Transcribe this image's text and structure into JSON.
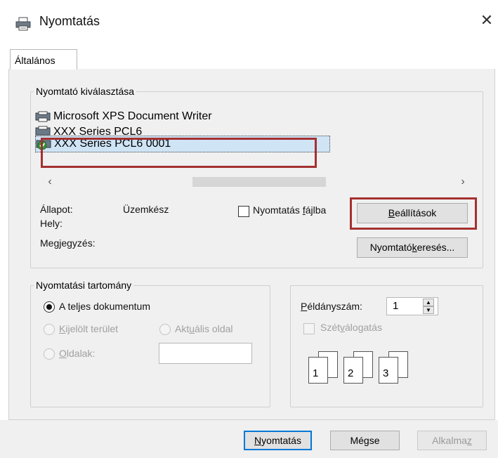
{
  "window": {
    "title": "Nyomtatás",
    "close_glyph": "✕",
    "icon": "printer-icon"
  },
  "tabs": [
    {
      "label": "Általános"
    }
  ],
  "printer_select": {
    "group_label": "Nyomtató kiválasztása",
    "printers": [
      {
        "name": "Microsoft XPS Document Writer",
        "icon": "printer-icon"
      },
      {
        "name": "XXX  Series PCL6",
        "icon": "printer-icon"
      },
      {
        "name": "XXX  Series PCL6 0001",
        "icon": "default-printer-icon",
        "selected": true
      }
    ],
    "scroll_left": "‹",
    "scroll_right": "›",
    "status_label": "Állapot:",
    "status_value": "Üzemkész",
    "location_label": "Hely:",
    "comment_label": "Megjegyzés:",
    "print_to_file": {
      "before": "Nyomtatás ",
      "u": "f",
      "after": "ájlba",
      "checked": false
    },
    "settings_button": {
      "u": "B",
      "after": "eállítások"
    },
    "find_button": {
      "before": "Nyomtató",
      "u": "k",
      "after": "eresés..."
    }
  },
  "page_range": {
    "group_label": "Nyomtatási tartomány",
    "all": {
      "before": "A tel",
      "u": "j",
      "after": "es dokumentum",
      "checked": true
    },
    "selection": {
      "u": "K",
      "after": "ijelölt terület",
      "enabled": false
    },
    "current": {
      "before": "Akt",
      "u": "u",
      "after": "ális oldal",
      "enabled": false
    },
    "pages": {
      "u": "O",
      "after": "ldalak:",
      "enabled": false,
      "value": ""
    }
  },
  "copies": {
    "label_u": "P",
    "label_after": "éldányszám:",
    "value": "1",
    "spin_up": "▲",
    "spin_down": "▼",
    "collate": {
      "before": "Szét",
      "u": "v",
      "after": "álogatás",
      "checked": false,
      "enabled": false
    },
    "collate_pages": [
      {
        "back": "1",
        "front": "1"
      },
      {
        "back": "2",
        "front": "2"
      },
      {
        "back": "3",
        "front": "3"
      }
    ]
  },
  "footer": {
    "print": {
      "u": "N",
      "after": "yomtatás"
    },
    "cancel": "Mégse",
    "apply": {
      "before": "Alkalma",
      "u": "z"
    }
  },
  "colors": {
    "accent": "#0078d7",
    "highlight": "#a53030",
    "selection": "#cfe4f5",
    "panel": "#f0f0f0"
  }
}
